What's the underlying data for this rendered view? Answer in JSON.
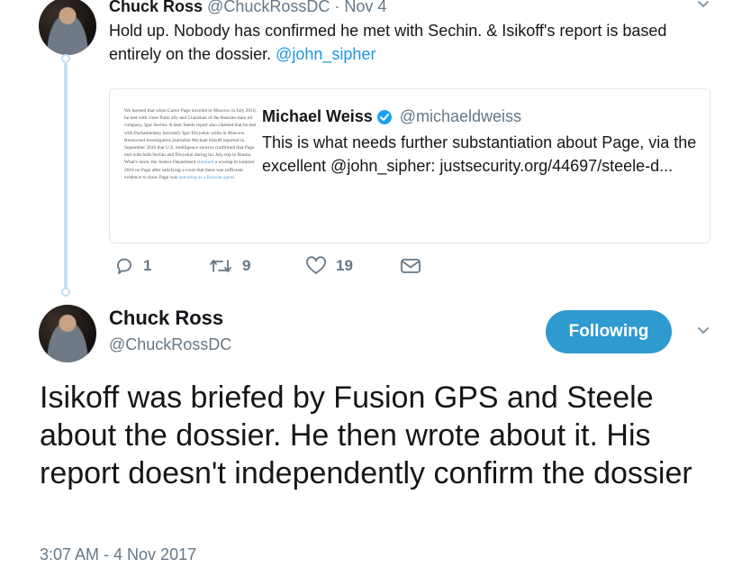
{
  "reply_tweet": {
    "author_name": "Chuck Ross",
    "author_handle": "@ChuckRossDC",
    "date_sep": "·",
    "date": "Nov 4",
    "text": "Hold up. Nobody has confirmed he met with Sechin. & Isikoff's report is based entirely on the dossier. ",
    "mention": "@john_sipher",
    "quoted_tweet": {
      "author_name": "Michael Weiss",
      "author_handle": "@michaeldweiss",
      "text": "This is what needs further substantiation about Page, via the excellent @john_sipher: justsecurity.org/44697/steele-d...",
      "image_text_a": "We learned that when Carter Page traveled to Moscow in July 2016, he met with close Putin ally and Chairman of the Russian state oil company, Igor Sechin. A later Steele report also claimed that he met with Parliamentary Secretary Igor Divyekin while in Moscow. Renowned investigative journalist Michael Isikoff reported in September 2016 that U.S. intelligence sources confirmed that Page met with both Sechin and Divyekin during his July trip to Russia. What's more, the Justice Department ",
      "image_link_1": "obtained",
      "image_text_b": " a wiretap in summer 2016 on Page after satisfying a court that there was sufficient evidence to show Page was ",
      "image_link_2": "operating as a Russian agent",
      "image_text_c": "."
    },
    "actions": {
      "replies": "1",
      "retweets": "9",
      "likes": "19"
    }
  },
  "main_tweet": {
    "author_name": "Chuck Ross",
    "author_handle": "@ChuckRossDC",
    "follow_label": "Following",
    "text": "Isikoff was briefed by Fusion GPS and Steele about the dossier. He then wrote about it. His report doesn't independently confirm the dossier",
    "timestamp": "3:07 AM - 4 Nov 2017"
  },
  "colors": {
    "accent": "#1b95e0",
    "follow_button": "#2e9ad0",
    "muted_text": "#657786",
    "thread_line": "#c4e2f5",
    "verified": "#1da1f2"
  },
  "icons": [
    "chevron-down-icon",
    "verified-badge-icon",
    "reply-icon",
    "retweet-icon",
    "like-heart-icon",
    "direct-message-icon"
  ]
}
